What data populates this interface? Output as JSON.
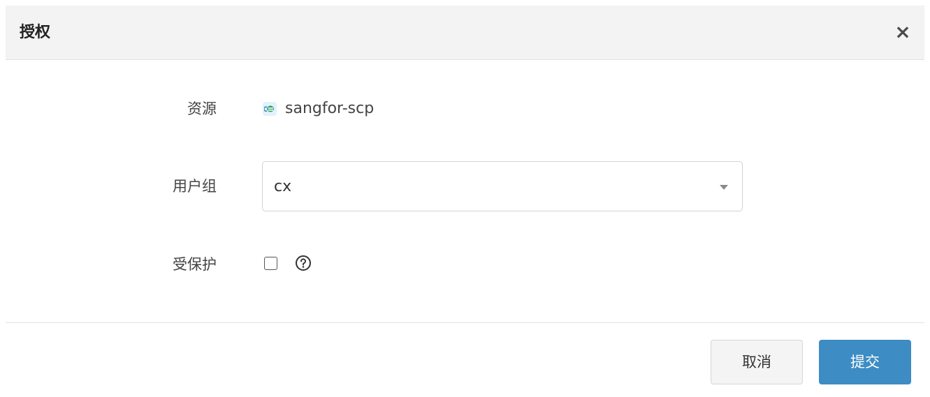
{
  "dialog": {
    "title": "授权",
    "close_label": "×"
  },
  "form": {
    "resource": {
      "label": "资源",
      "icon": "cloud-app-icon",
      "value": "sangfor-scp"
    },
    "user_group": {
      "label": "用户组",
      "value": "cx"
    },
    "protected": {
      "label": "受保护",
      "checked": false,
      "help_icon": "question-circle-icon"
    }
  },
  "footer": {
    "cancel_label": "取消",
    "submit_label": "提交"
  },
  "colors": {
    "primary": "#3d8cc3",
    "header_bg": "#f3f3f3"
  }
}
